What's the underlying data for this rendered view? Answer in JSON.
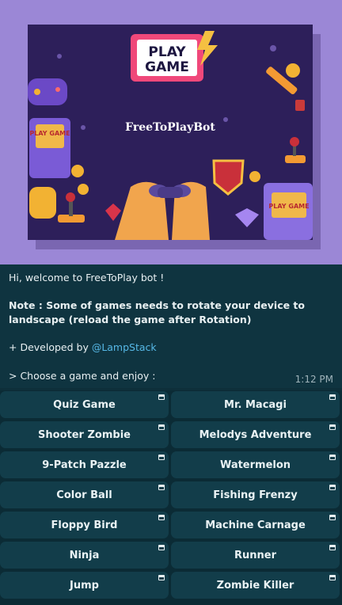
{
  "poster": {
    "title_line1": "PLAY",
    "title_line2": "GAME",
    "brand": "FreeToPlayBot",
    "side_screen_left": "PLAY GAME",
    "side_screen_right": "PLAY GAME"
  },
  "message": {
    "greeting": "Hi, welcome to FreeToPlay bot !",
    "note": "Note : Some of games needs to rotate your device to landscape (reload the game after Rotation)",
    "developed_prefix": "+ Developed by ",
    "developer_handle": "@LampStack",
    "choose": "> Choose a game and enjoy :",
    "time": "1:12 PM"
  },
  "keyboard": {
    "rows": [
      [
        "Quiz Game",
        "Mr. Macagi"
      ],
      [
        "Shooter Zombie",
        "Melodys Adventure"
      ],
      [
        "9-Patch Pazzle",
        "Watermelon"
      ],
      [
        "Color Ball",
        "Fishing Frenzy"
      ],
      [
        "Floppy Bird",
        "Machine Carnage"
      ],
      [
        "Ninja",
        "Runner"
      ],
      [
        "Jump",
        "Zombie Killer"
      ]
    ]
  }
}
